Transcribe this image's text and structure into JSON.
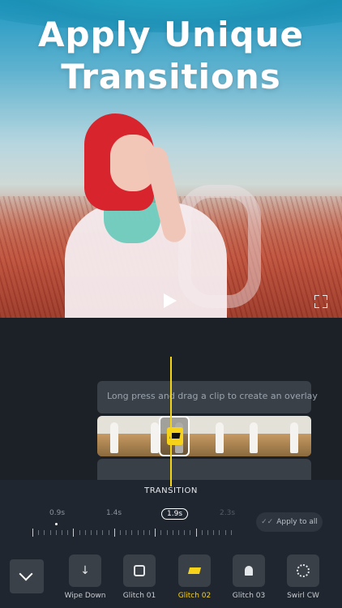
{
  "promo": {
    "headline_line1": "Apply Unique",
    "headline_line2": "Transitions"
  },
  "editor": {
    "overlay_hint": "Long press and drag a clip to create an overlay",
    "transition_label": "TRANSITION",
    "duration_ticks": [
      "0.9s",
      "1.4s",
      "1.9s",
      "2.3s"
    ],
    "selected_duration": "1.9s",
    "apply_all_label": "Apply to all"
  },
  "transitions": {
    "items": [
      {
        "label": "Wipe Down",
        "icon": "arrow-down-icon"
      },
      {
        "label": "Glitch 01",
        "icon": "glitch-01-icon"
      },
      {
        "label": "Glitch 02",
        "icon": "glitch-02-icon"
      },
      {
        "label": "Glitch 03",
        "icon": "ghost-icon"
      },
      {
        "label": "Swirl CW",
        "icon": "swirl-icon"
      }
    ],
    "selected": "Glitch 02"
  },
  "colors": {
    "accent": "#f7d21a",
    "panel": "#202630",
    "track": "#3a4048"
  }
}
